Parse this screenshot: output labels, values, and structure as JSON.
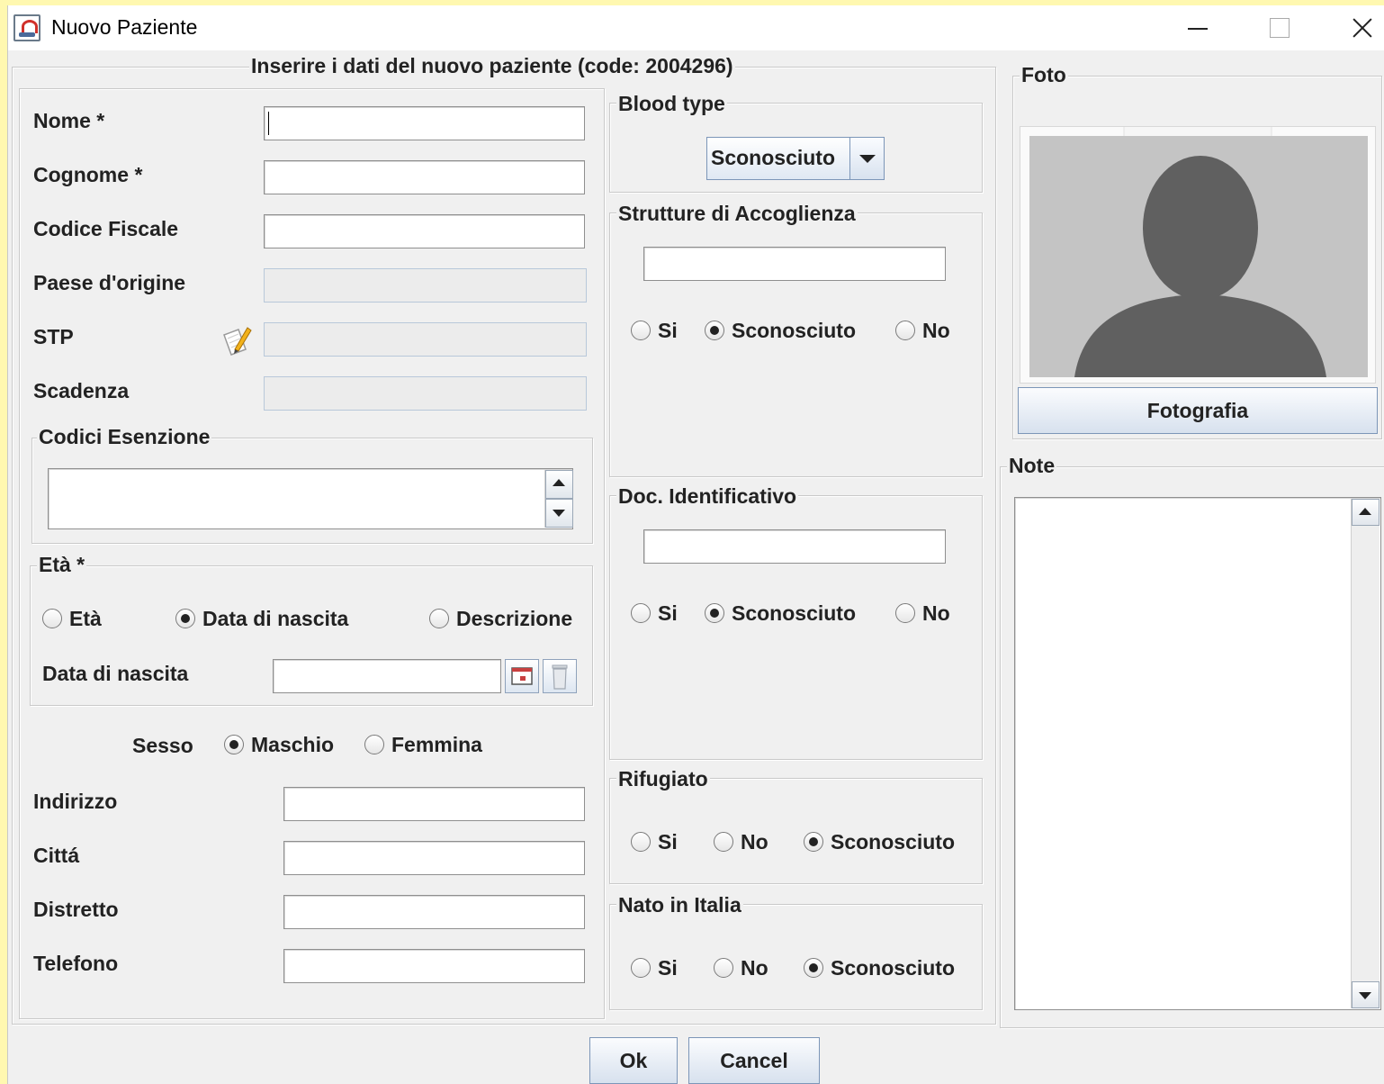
{
  "window": {
    "title": "Nuovo Paziente",
    "minimize_icon": "minimize-icon",
    "maximize_icon": "maximize-icon",
    "close_icon": "close-icon"
  },
  "main_panel": {
    "title": "Inserire i dati del nuovo paziente (code: 2004296)",
    "fields": {
      "nome": {
        "label": "Nome *",
        "value": ""
      },
      "cognome": {
        "label": "Cognome *",
        "value": ""
      },
      "codice_fiscale": {
        "label": "Codice Fiscale",
        "value": ""
      },
      "paese": {
        "label": "Paese d'origine",
        "value": ""
      },
      "stp": {
        "label": "STP",
        "value": ""
      },
      "scadenza": {
        "label": "Scadenza",
        "value": ""
      }
    },
    "codici_esenzione": {
      "title": "Codici Esenzione",
      "value": ""
    },
    "eta": {
      "title": "Età *",
      "options": {
        "eta": "Età",
        "data_nascita": "Data di nascita",
        "descrizione": "Descrizione"
      },
      "selected": "data_nascita",
      "data_nascita_label": "Data di nascita",
      "data_nascita_value": ""
    },
    "sesso": {
      "label": "Sesso",
      "options": {
        "maschio": "Maschio",
        "femmina": "Femmina"
      },
      "selected": "maschio"
    },
    "address_fields": {
      "indirizzo": {
        "label": "Indirizzo",
        "value": ""
      },
      "citta": {
        "label": "Cittá",
        "value": ""
      },
      "distretto": {
        "label": "Distretto",
        "value": ""
      },
      "telefono": {
        "label": "Telefono",
        "value": ""
      }
    }
  },
  "blood_type": {
    "title": "Blood type",
    "selected": "Sconosciuto"
  },
  "strutture": {
    "title": "Strutture di Accoglienza",
    "value": "",
    "options": {
      "si": "Si",
      "sconosciuto": "Sconosciuto",
      "no": "No"
    },
    "selected": "sconosciuto"
  },
  "doc_identificativo": {
    "title": "Doc. Identificativo",
    "value": "",
    "options": {
      "si": "Si",
      "sconosciuto": "Sconosciuto",
      "no": "No"
    },
    "selected": "sconosciuto"
  },
  "rifugiato": {
    "title": "Rifugiato",
    "options": {
      "si": "Si",
      "no": "No",
      "sconosciuto": "Sconosciuto"
    },
    "selected": "sconosciuto"
  },
  "nato_italia": {
    "title": "Nato in Italia",
    "options": {
      "si": "Si",
      "no": "No",
      "sconosciuto": "Sconosciuto"
    },
    "selected": "sconosciuto"
  },
  "foto": {
    "title": "Foto",
    "button": "Fotografia"
  },
  "note": {
    "title": "Note",
    "value": ""
  },
  "buttons": {
    "ok": "Ok",
    "cancel": "Cancel"
  },
  "colors": {
    "background": "#f0f0f0",
    "outer": "#fff8b0",
    "button_top": "#fbfcfe",
    "button_bottom": "#d7e1ee"
  }
}
